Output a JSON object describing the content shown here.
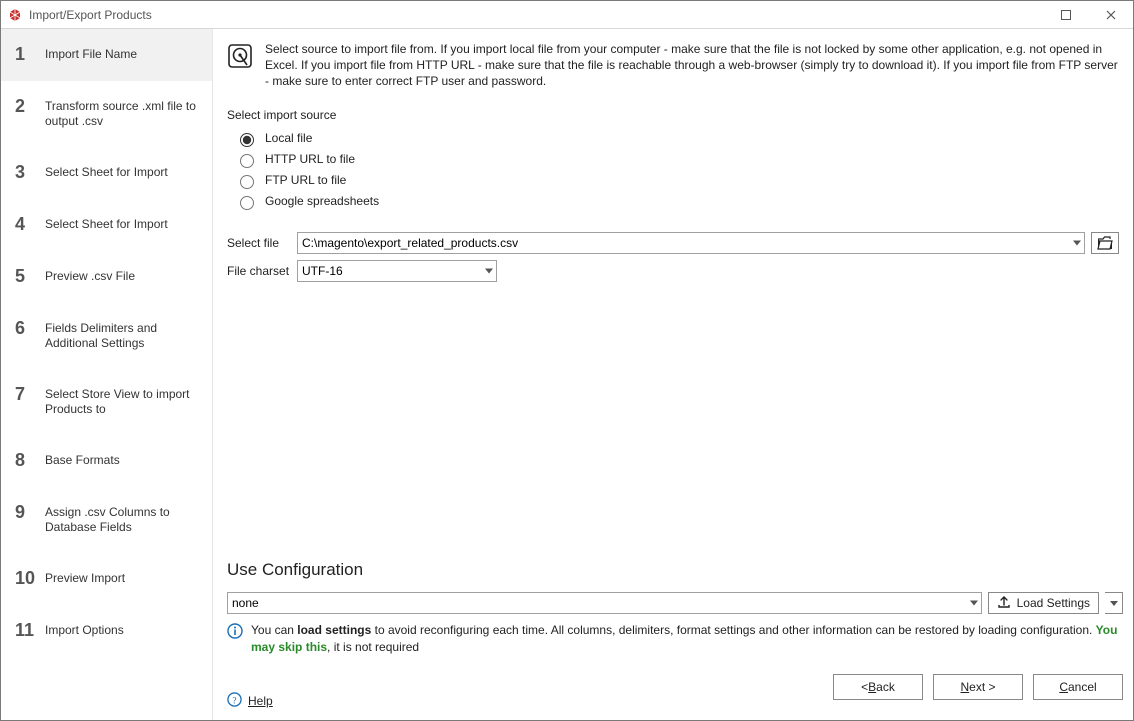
{
  "window": {
    "title": "Import/Export Products"
  },
  "sidebar": {
    "steps": [
      {
        "num": "1",
        "label": "Import File Name",
        "active": true
      },
      {
        "num": "2",
        "label": "Transform source .xml file to output .csv"
      },
      {
        "num": "3",
        "label": "Select Sheet for Import"
      },
      {
        "num": "4",
        "label": "Select Sheet for Import"
      },
      {
        "num": "5",
        "label": "Preview .csv File"
      },
      {
        "num": "6",
        "label": "Fields Delimiters and Additional Settings"
      },
      {
        "num": "7",
        "label": "Select Store View to import Products to"
      },
      {
        "num": "8",
        "label": "Base Formats"
      },
      {
        "num": "9",
        "label": "Assign .csv Columns to Database Fields"
      },
      {
        "num": "10",
        "label": "Preview Import"
      },
      {
        "num": "11",
        "label": "Import Options"
      }
    ]
  },
  "intro": "Select source to import file from. If you import local file from your computer - make sure that the file is not locked by some other application, e.g. not opened in Excel. If you import file from HTTP URL - make sure that the file is reachable through a web-browser (simply try to download it). If you import file from FTP server - make sure to enter correct FTP user and password.",
  "source": {
    "heading": "Select import source",
    "options": {
      "local": "Local file",
      "http": "HTTP URL to file",
      "ftp": "FTP URL to file",
      "google": "Google spreadsheets"
    },
    "selected": "local"
  },
  "file": {
    "label": "Select file",
    "value": "C:\\magento\\export_related_products.csv"
  },
  "charset": {
    "label": "File charset",
    "value": "UTF-16"
  },
  "config": {
    "heading": "Use Configuration",
    "selected": "none",
    "load_label": "Load Settings",
    "info_prefix": "You can ",
    "info_bold": "load settings",
    "info_mid": " to avoid reconfiguring each time. All columns, delimiters, format settings and other information can be restored by loading configuration. ",
    "info_green": "You may skip this",
    "info_suffix": ", it is not required"
  },
  "footer": {
    "help": "Help",
    "back": "< Back",
    "next": "Next >",
    "cancel": "Cancel"
  }
}
